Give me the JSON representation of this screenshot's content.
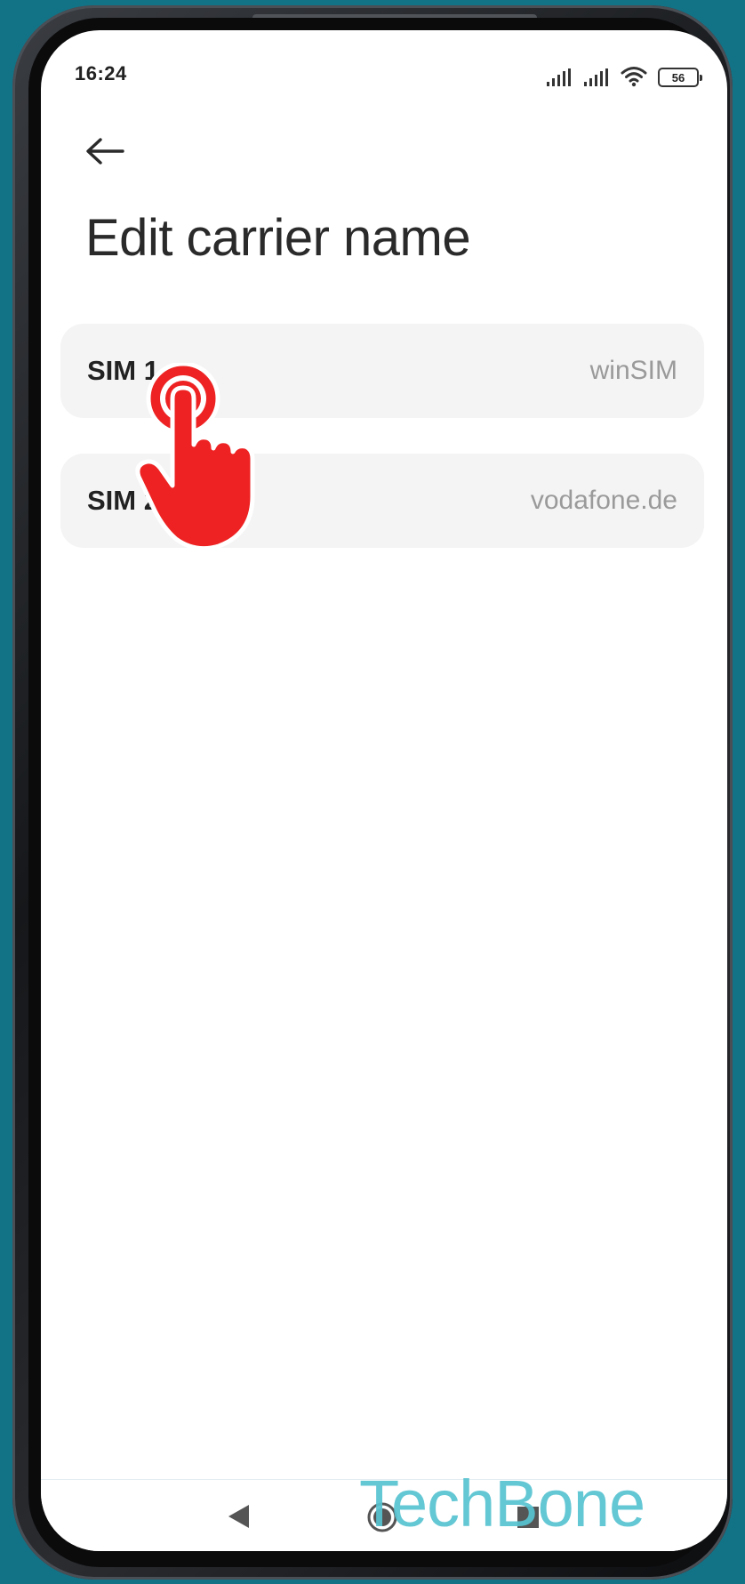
{
  "status_bar": {
    "time": "16:24",
    "battery_level": "56",
    "icons": [
      "signal-icon",
      "signal-icon",
      "wifi-icon",
      "battery-icon"
    ]
  },
  "header": {
    "back_icon": "back-arrow-icon",
    "title": "Edit carrier name"
  },
  "sim_list": [
    {
      "label": "SIM 1",
      "value": "winSIM"
    },
    {
      "label": "SIM 2",
      "value": "vodafone.de"
    }
  ],
  "nav_bar": {
    "icons": [
      "nav-back-icon",
      "nav-home-icon",
      "nav-recents-icon"
    ]
  },
  "overlay": {
    "tap_indicator_icon": "tap-hand-icon",
    "watermark": "TechBone"
  },
  "colors": {
    "background": "#137386",
    "watermark": "#57c3d1",
    "tap_hand": "#ee2222",
    "row_bg": "#f4f4f4"
  }
}
